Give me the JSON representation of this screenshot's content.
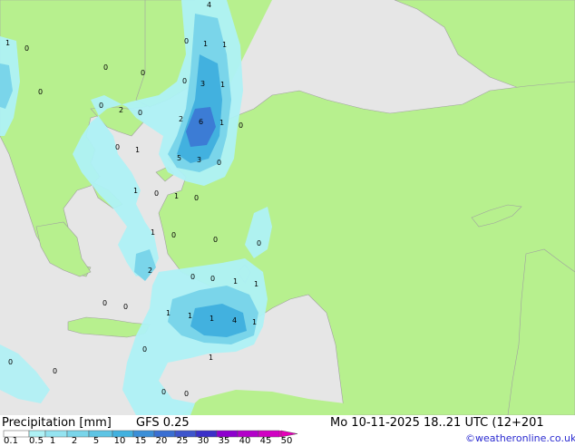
{
  "footer": {
    "title": "Precipitation [mm]",
    "model": "GFS 0.25",
    "datetime": "Mo 10-11-2025 18..21 UTC (12+201",
    "credit": "©weatheronline.co.uk"
  },
  "legend": {
    "ticks": [
      "0.1",
      "0.5",
      "1",
      "2",
      "5",
      "10",
      "15",
      "20",
      "25",
      "30",
      "35",
      "40",
      "45",
      "50"
    ],
    "colors": [
      "#ffffff",
      "#aef1f5",
      "#94e3f0",
      "#7ad5ea",
      "#5ec4e4",
      "#42b1df",
      "#3b8fd8",
      "#3a6fd2",
      "#3e55cc",
      "#3b2fc8",
      "#8e00ce",
      "#b300c9",
      "#d100c3",
      "#e500b8"
    ]
  },
  "map": {
    "colors": {
      "land": "#b7f08e",
      "sea": "#e6e6e6",
      "precip_light": "#aef1f5",
      "precip_mid": "#7ad5ea",
      "precip_heavy": "#42b1df",
      "precip_max": "#3b6fd2",
      "border": "#a0a0a0"
    },
    "labels": [
      {
        "id": "l1",
        "text": "4"
      },
      {
        "id": "l2",
        "text": "1"
      },
      {
        "id": "l3",
        "text": "0"
      },
      {
        "id": "l4",
        "text": "0"
      },
      {
        "id": "l5",
        "text": "1"
      },
      {
        "id": "l6",
        "text": "1"
      },
      {
        "id": "l7",
        "text": "0"
      },
      {
        "id": "l8",
        "text": "0"
      },
      {
        "id": "l9",
        "text": "0"
      },
      {
        "id": "l10",
        "text": "3"
      },
      {
        "id": "l11",
        "text": "1"
      },
      {
        "id": "l12",
        "text": "0"
      },
      {
        "id": "l13",
        "text": "2"
      },
      {
        "id": "l14",
        "text": "0"
      },
      {
        "id": "l15",
        "text": "0"
      },
      {
        "id": "l16",
        "text": "2"
      },
      {
        "id": "l17",
        "text": "6"
      },
      {
        "id": "l18",
        "text": "1"
      },
      {
        "id": "l19",
        "text": "0"
      },
      {
        "id": "l20",
        "text": "0"
      },
      {
        "id": "l21",
        "text": "1"
      },
      {
        "id": "l22",
        "text": "5"
      },
      {
        "id": "l23",
        "text": "3"
      },
      {
        "id": "l24",
        "text": "0"
      },
      {
        "id": "l25",
        "text": "1"
      },
      {
        "id": "l26",
        "text": "0"
      },
      {
        "id": "l27",
        "text": "1"
      },
      {
        "id": "l28",
        "text": "0"
      },
      {
        "id": "l29",
        "text": "1"
      },
      {
        "id": "l30",
        "text": "0"
      },
      {
        "id": "l31",
        "text": "0"
      },
      {
        "id": "l32",
        "text": "0"
      },
      {
        "id": "l33",
        "text": "2"
      },
      {
        "id": "l34",
        "text": "0"
      },
      {
        "id": "l35",
        "text": "0"
      },
      {
        "id": "l36",
        "text": "1"
      },
      {
        "id": "l37",
        "text": "1"
      },
      {
        "id": "l38",
        "text": "0"
      },
      {
        "id": "l39",
        "text": "0"
      },
      {
        "id": "l40",
        "text": "1"
      },
      {
        "id": "l41",
        "text": "1"
      },
      {
        "id": "l42",
        "text": "1"
      },
      {
        "id": "l43",
        "text": "4"
      },
      {
        "id": "l44",
        "text": "1"
      },
      {
        "id": "l45",
        "text": "0"
      },
      {
        "id": "l46",
        "text": "1"
      },
      {
        "id": "l47",
        "text": "0"
      },
      {
        "id": "l48",
        "text": "0"
      },
      {
        "id": "l49",
        "text": "0"
      },
      {
        "id": "l50",
        "text": "0"
      }
    ]
  }
}
